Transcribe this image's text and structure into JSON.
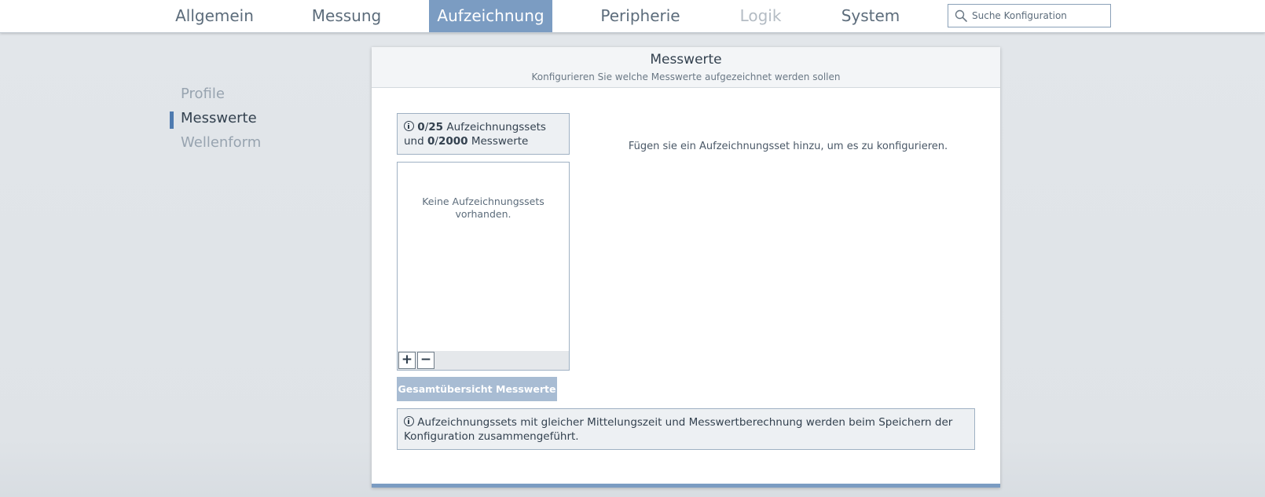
{
  "topnav": {
    "tabs": [
      {
        "label": "Allgemein",
        "state": "normal"
      },
      {
        "label": "Messung",
        "state": "normal"
      },
      {
        "label": "Aufzeichnung",
        "state": "active"
      },
      {
        "label": "Peripherie",
        "state": "normal"
      },
      {
        "label": "Logik",
        "state": "disabled"
      },
      {
        "label": "System",
        "state": "normal"
      }
    ],
    "search": {
      "placeholder": "Suche Konfiguration",
      "value": ""
    }
  },
  "sidebar": {
    "items": [
      {
        "label": "Profile",
        "active": false
      },
      {
        "label": "Messwerte",
        "active": true
      },
      {
        "label": "Wellenform",
        "active": false
      }
    ]
  },
  "panel": {
    "title": "Messwerte",
    "subtitle": "Konfigurieren Sie welche Messwerte aufgezeichnet werden sollen",
    "stats": {
      "sets_used": "0",
      "sets_max": "25",
      "sets_label": "Aufzeichnungssets",
      "connector": "und",
      "values_used": "0",
      "values_max": "2000",
      "values_label": "Messwerte"
    },
    "list": {
      "empty_message": "Keine Aufzeichnungssets vorhanden.",
      "add_label": "+",
      "remove_label": "−"
    },
    "overview_button": "Gesamtübersicht Messwerte",
    "right_placeholder": "Fügen sie ein Aufzeichnungsset hinzu, um es zu konfigurieren.",
    "hint": "Aufzeichnungssets mit gleicher Mittelungszeit und Messwertberechnung werden beim Speichern der Konfiguration zusammengeführt."
  },
  "colors": {
    "accent": "#7b9cc2",
    "marker": "#4f7bb0",
    "button_disabled": "#a8bcd3",
    "info_bg": "#edf0f3"
  }
}
